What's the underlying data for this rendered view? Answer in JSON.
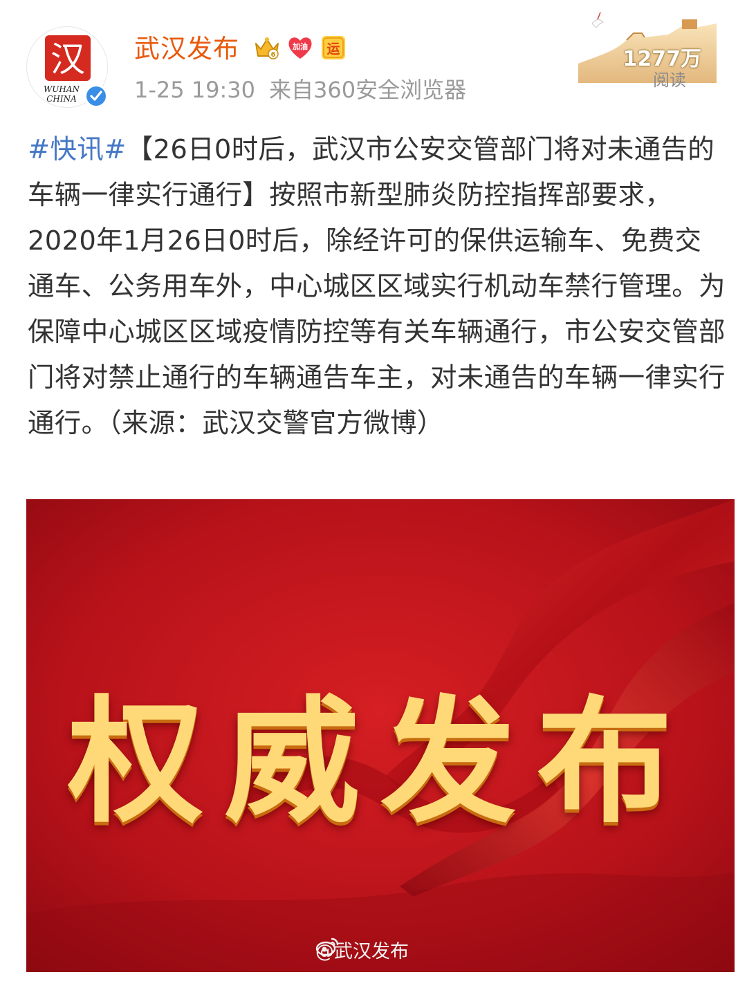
{
  "header": {
    "username": "武汉发布",
    "avatar_text": "汉",
    "avatar_caption_1": "WUHAN",
    "avatar_caption_2": "CHINA",
    "time": "1-25 19:30",
    "source": "来自360安全浏览器",
    "badges": [
      "vip-crown-icon",
      "jiayou-heart-icon",
      "yun-badge-icon"
    ],
    "badge_heart_text": "加油",
    "badge_yun_text": "运",
    "read_count": "1277万",
    "read_label": "阅读"
  },
  "post": {
    "hashtag": "#快讯#",
    "body": "【26日0时后，武汉市公安交管部门将对未通告的车辆一律实行通行】按照市新型肺炎防控指挥部要求，2020年1月26日0时后，除经许可的保供运输车、免费交通车、公务用车外，中心城区区域实行机动车禁行管理。为保障中心城区区域疫情防控等有关车辆通行，市公安交管部门将对禁止通行的车辆通告车主，对未通告的车辆一律实行通行。（来源：武汉交警官方微博）"
  },
  "image": {
    "title": "权威发布",
    "watermark": "@武汉发布",
    "bg_color": "#c4161c",
    "title_color": "#ffd977"
  },
  "colors": {
    "username": "#e8590c",
    "hashtag": "#4577c5",
    "meta": "#9a9a9a",
    "text": "#333333"
  }
}
